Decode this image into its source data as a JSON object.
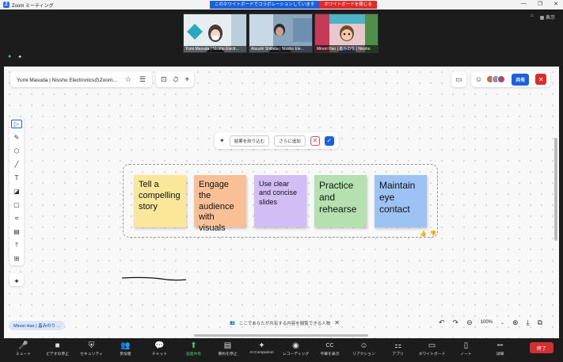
{
  "window": {
    "title": "Zoom ミーティング",
    "collab_banner": "このホワイトボードでコラボレーションしています",
    "stop_whiteboard": "ホワイトボードを閉じる",
    "controls": [
      "—",
      "❐",
      "✕"
    ]
  },
  "video_strip": {
    "tiles": [
      {
        "name": "Yumi Masuda | Nissho Electr..."
      },
      {
        "name": "Atsushi Shibata | Nissho Ele..."
      },
      {
        "name": "Minori Han | 畠みのり | Nissho"
      }
    ],
    "view_label": "表示"
  },
  "board": {
    "title": "Yumi Masuda | Nissho ElectronicsのZoom...",
    "share_label": "共有",
    "ai_bar": {
      "narrow_label": "結果を絞り込む",
      "add_label": "さらに追加"
    },
    "stickies": [
      {
        "text": "Tell a compelling story",
        "color": "#fbe79a"
      },
      {
        "text": "Engage the audience with visuals",
        "color": "#f9c095"
      },
      {
        "text": "Use clear and concise slides",
        "color": "#d2bdf5"
      },
      {
        "text": "Practice and rehearse",
        "color": "#b5e0b0"
      },
      {
        "text": "Maintain eye contact",
        "color": "#9dc3f5"
      }
    ],
    "hint": "ここであなたが共有する内容を閲覧できる人物",
    "name_tag": "Minori Han | 畠みのり ...",
    "zoom_level": "100%"
  },
  "bottom_toolbar": {
    "items": [
      {
        "icon": "mic-icon",
        "glyph": "🎤",
        "label": "ミュート"
      },
      {
        "icon": "video-icon",
        "glyph": "■",
        "label": "ビデオの停止"
      },
      {
        "icon": "security-icon",
        "glyph": "⛨",
        "label": "セキュリティ"
      },
      {
        "icon": "participants-icon",
        "glyph": "👥",
        "label": "参加者"
      },
      {
        "icon": "chat-icon",
        "glyph": "💬",
        "label": "チャット"
      },
      {
        "icon": "share-screen-icon",
        "glyph": "⬆",
        "label": "画面共有",
        "active": true
      },
      {
        "icon": "summary-icon",
        "glyph": "▤",
        "label": "要約を停止"
      },
      {
        "icon": "ai-companion-icon",
        "glyph": "✦",
        "label": "AI Companion"
      },
      {
        "icon": "record-icon",
        "glyph": "◉",
        "label": "レコーディング"
      },
      {
        "icon": "captions-icon",
        "glyph": "CC",
        "label": "字幕を表示"
      },
      {
        "icon": "reactions-icon",
        "glyph": "☺",
        "label": "リアクション"
      },
      {
        "icon": "apps-icon",
        "glyph": "⚏",
        "label": "アプリ"
      },
      {
        "icon": "whiteboard-icon",
        "glyph": "▭",
        "label": "ホワイトボード"
      },
      {
        "icon": "notes-icon",
        "glyph": "▯",
        "label": "ノート"
      },
      {
        "icon": "more-icon",
        "glyph": "•••",
        "label": "詳細"
      }
    ],
    "end_label": "終了"
  }
}
